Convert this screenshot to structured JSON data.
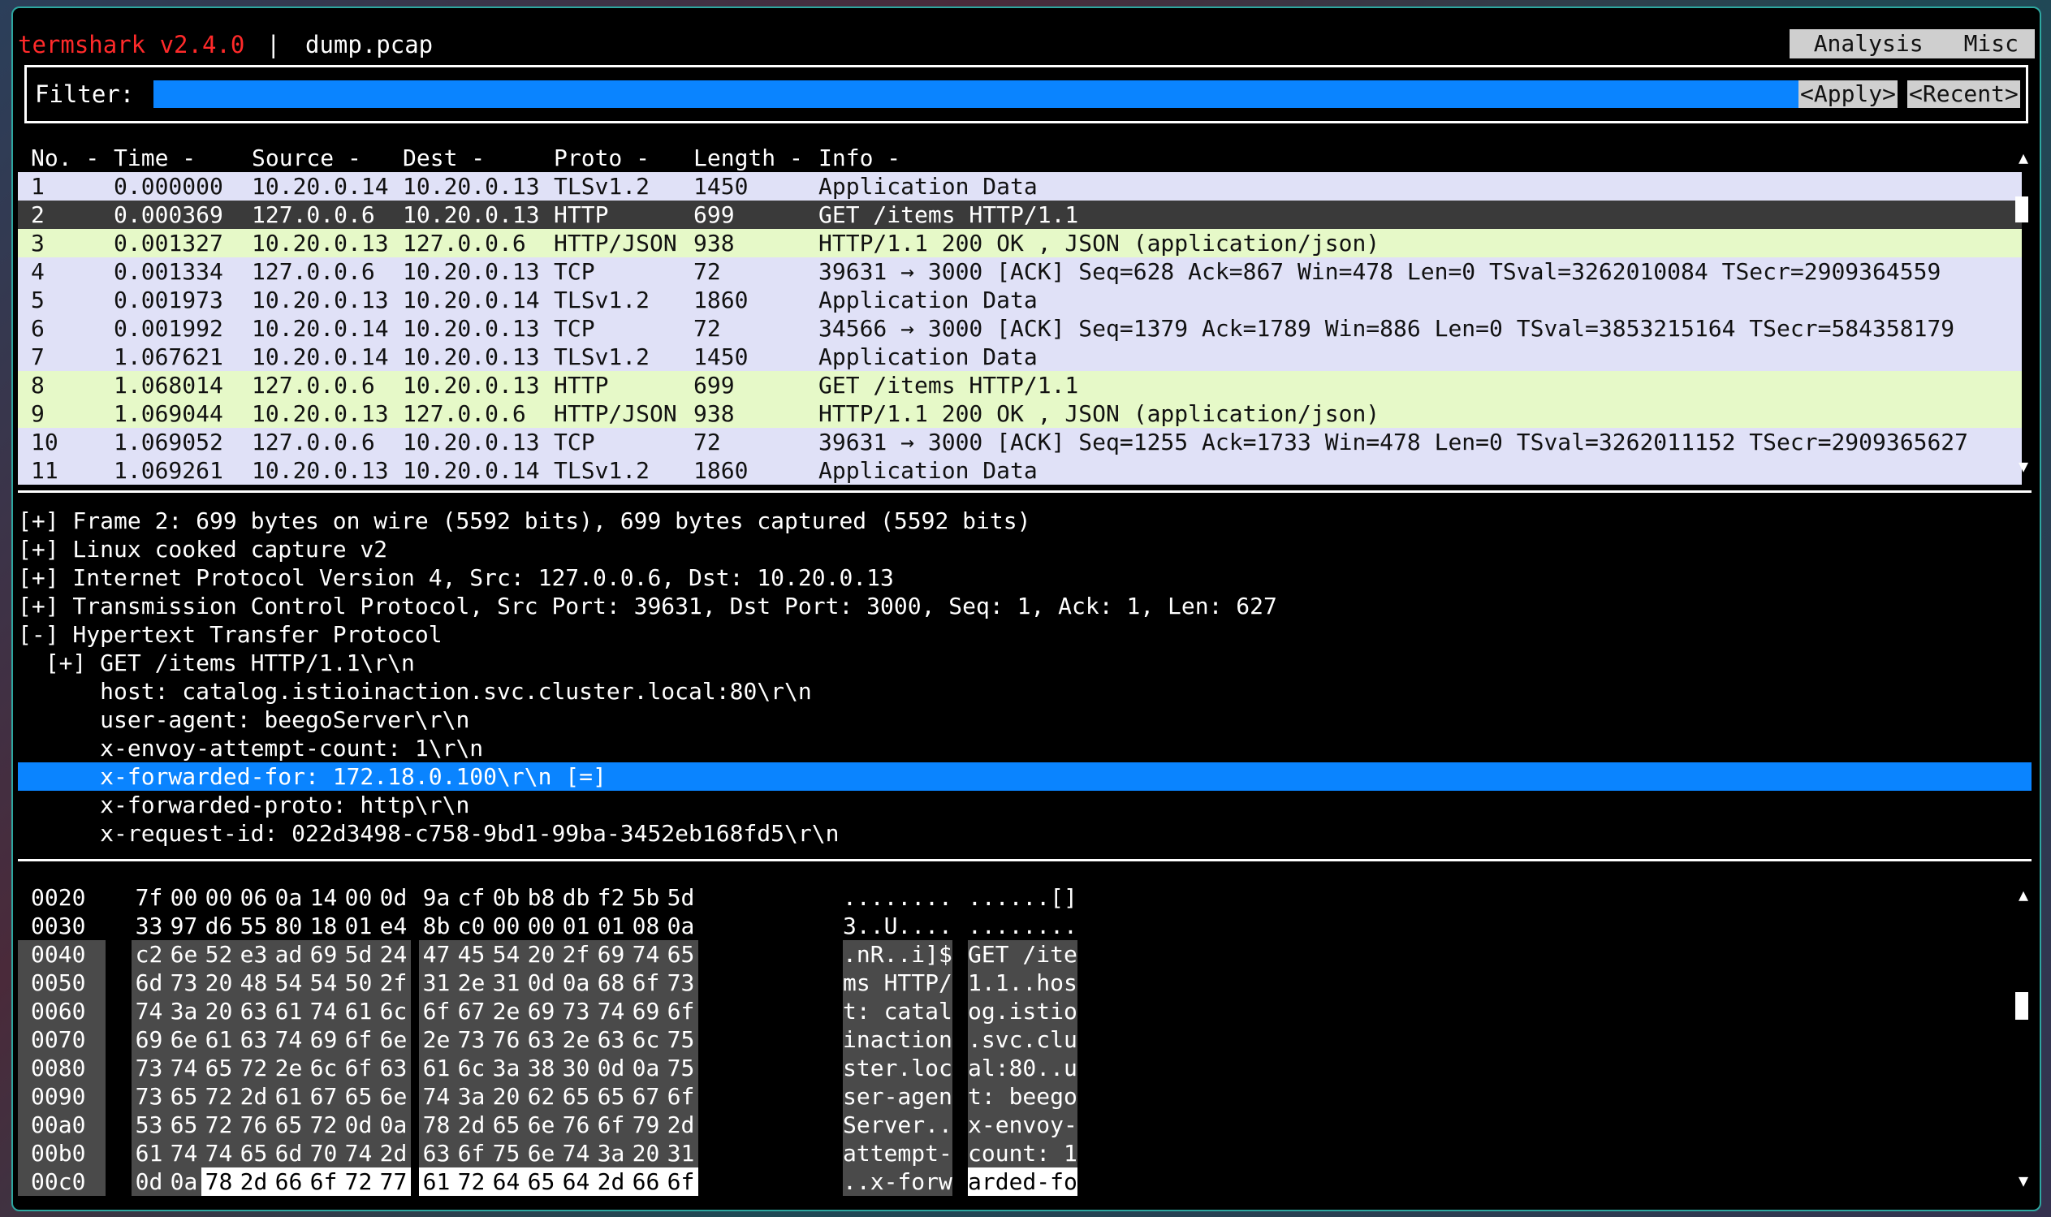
{
  "app": {
    "title": "termshark v2.4.0",
    "separator": "|",
    "file": "dump.pcap"
  },
  "menu": {
    "analysis": "Analysis",
    "misc": "Misc"
  },
  "filter": {
    "label": "Filter:",
    "value": "",
    "apply": "<Apply>",
    "recent": "<Recent>"
  },
  "colors": {
    "tls": "#e0e1f7",
    "http": "#e6f9c8",
    "selected": "#3a3a3a",
    "accent": "#0a84ff",
    "title": "#ff2a2a"
  },
  "packet_list": {
    "columns": [
      "No. -",
      "Time -",
      "Source -",
      "Dest -",
      "Proto -",
      "Length -",
      "Info -"
    ],
    "rows": [
      [
        "1",
        "0.000000",
        "10.20.0.14",
        "10.20.0.13",
        "TLSv1.2",
        "1450",
        "Application Data"
      ],
      [
        "2",
        "0.000369",
        "127.0.0.6",
        "10.20.0.13",
        "HTTP",
        "699",
        "GET /items HTTP/1.1"
      ],
      [
        "3",
        "0.001327",
        "10.20.0.13",
        "127.0.0.6",
        "HTTP/JSON",
        "938",
        "HTTP/1.1 200 OK , JSON (application/json)"
      ],
      [
        "4",
        "0.001334",
        "127.0.0.6",
        "10.20.0.13",
        "TCP",
        "72",
        "39631 → 3000 [ACK] Seq=628 Ack=867 Win=478 Len=0 TSval=3262010084 TSecr=2909364559"
      ],
      [
        "5",
        "0.001973",
        "10.20.0.13",
        "10.20.0.14",
        "TLSv1.2",
        "1860",
        "Application Data"
      ],
      [
        "6",
        "0.001992",
        "10.20.0.14",
        "10.20.0.13",
        "TCP",
        "72",
        "34566 → 3000 [ACK] Seq=1379 Ack=1789 Win=886 Len=0 TSval=3853215164 TSecr=584358179"
      ],
      [
        "7",
        "1.067621",
        "10.20.0.14",
        "10.20.0.13",
        "TLSv1.2",
        "1450",
        "Application Data"
      ],
      [
        "8",
        "1.068014",
        "127.0.0.6",
        "10.20.0.13",
        "HTTP",
        "699",
        "GET /items HTTP/1.1"
      ],
      [
        "9",
        "1.069044",
        "10.20.0.13",
        "127.0.0.6",
        "HTTP/JSON",
        "938",
        "HTTP/1.1 200 OK , JSON (application/json)"
      ],
      [
        "10",
        "1.069052",
        "127.0.0.6",
        "10.20.0.13",
        "TCP",
        "72",
        "39631 → 3000 [ACK] Seq=1255 Ack=1733 Win=478 Len=0 TSval=3262011152 TSecr=2909365627"
      ],
      [
        "11",
        "1.069261",
        "10.20.0.13",
        "10.20.0.14",
        "TLSv1.2",
        "1860",
        "Application Data"
      ]
    ],
    "row_kinds": [
      "tls",
      "sel",
      "http",
      "tls",
      "tls",
      "tls",
      "tls",
      "http",
      "http",
      "tls",
      "tls"
    ],
    "scroll_up": "▲",
    "scroll_down": "▼"
  },
  "details": {
    "lines": [
      "[+] Frame 2: 699 bytes on wire (5592 bits), 699 bytes captured (5592 bits)",
      "[+] Linux cooked capture v2",
      "[+] Internet Protocol Version 4, Src: 127.0.0.6, Dst: 10.20.0.13",
      "[+] Transmission Control Protocol, Src Port: 39631, Dst Port: 3000, Seq: 1, Ack: 1, Len: 627",
      "[-] Hypertext Transfer Protocol",
      "  [+] GET /items HTTP/1.1\\r\\n",
      "      host: catalog.istioinaction.svc.cluster.local:80\\r\\n",
      "      user-agent: beegoServer\\r\\n",
      "      x-envoy-attempt-count: 1\\r\\n",
      "      x-forwarded-for: 172.18.0.100\\r\\n [=]",
      "      x-forwarded-proto: http\\r\\n",
      "      x-request-id: 022d3498-c758-9bd1-99ba-3452eb168fd5\\r\\n"
    ],
    "selected_index": 9
  },
  "hex": {
    "rows": [
      {
        "offset": "0020",
        "bytes": [
          "7f",
          "00",
          "00",
          "06",
          "0a",
          "14",
          "00",
          "0d",
          "9a",
          "cf",
          "0b",
          "b8",
          "db",
          "f2",
          "5b",
          "5d"
        ],
        "ascii": [
          "........",
          "......[]"
        ]
      },
      {
        "offset": "0030",
        "bytes": [
          "33",
          "97",
          "d6",
          "55",
          "80",
          "18",
          "01",
          "e4",
          "8b",
          "c0",
          "00",
          "00",
          "01",
          "01",
          "08",
          "0a"
        ],
        "ascii": [
          "3..U....",
          "........"
        ]
      },
      {
        "offset": "0040",
        "bytes": [
          "c2",
          "6e",
          "52",
          "e3",
          "ad",
          "69",
          "5d",
          "24",
          "47",
          "45",
          "54",
          "20",
          "2f",
          "69",
          "74",
          "65"
        ],
        "ascii": [
          ".nR..i]$",
          "GET /ite"
        ]
      },
      {
        "offset": "0050",
        "bytes": [
          "6d",
          "73",
          "20",
          "48",
          "54",
          "54",
          "50",
          "2f",
          "31",
          "2e",
          "31",
          "0d",
          "0a",
          "68",
          "6f",
          "73"
        ],
        "ascii": [
          "ms HTTP/",
          "1.1..hos"
        ]
      },
      {
        "offset": "0060",
        "bytes": [
          "74",
          "3a",
          "20",
          "63",
          "61",
          "74",
          "61",
          "6c",
          "6f",
          "67",
          "2e",
          "69",
          "73",
          "74",
          "69",
          "6f"
        ],
        "ascii": [
          "t: catal",
          "og.istio"
        ]
      },
      {
        "offset": "0070",
        "bytes": [
          "69",
          "6e",
          "61",
          "63",
          "74",
          "69",
          "6f",
          "6e",
          "2e",
          "73",
          "76",
          "63",
          "2e",
          "63",
          "6c",
          "75"
        ],
        "ascii": [
          "inaction",
          ".svc.clu"
        ]
      },
      {
        "offset": "0080",
        "bytes": [
          "73",
          "74",
          "65",
          "72",
          "2e",
          "6c",
          "6f",
          "63",
          "61",
          "6c",
          "3a",
          "38",
          "30",
          "0d",
          "0a",
          "75"
        ],
        "ascii": [
          "ster.loc",
          "al:80..u"
        ]
      },
      {
        "offset": "0090",
        "bytes": [
          "73",
          "65",
          "72",
          "2d",
          "61",
          "67",
          "65",
          "6e",
          "74",
          "3a",
          "20",
          "62",
          "65",
          "65",
          "67",
          "6f"
        ],
        "ascii": [
          "ser-agen",
          "t: beego"
        ]
      },
      {
        "offset": "00a0",
        "bytes": [
          "53",
          "65",
          "72",
          "76",
          "65",
          "72",
          "0d",
          "0a",
          "78",
          "2d",
          "65",
          "6e",
          "76",
          "6f",
          "79",
          "2d"
        ],
        "ascii": [
          "Server..",
          "x-envoy-"
        ]
      },
      {
        "offset": "00b0",
        "bytes": [
          "61",
          "74",
          "74",
          "65",
          "6d",
          "70",
          "74",
          "2d",
          "63",
          "6f",
          "75",
          "6e",
          "74",
          "3a",
          "20",
          "31"
        ],
        "ascii": [
          "attempt-",
          "count: 1"
        ]
      },
      {
        "offset": "00c0",
        "bytes": [
          "0d",
          "0a",
          "78",
          "2d",
          "66",
          "6f",
          "72",
          "77",
          "61",
          "72",
          "64",
          "65",
          "64",
          "2d",
          "66",
          "6f"
        ],
        "ascii": [
          "..x-forw",
          "arded-fo"
        ]
      }
    ]
  }
}
